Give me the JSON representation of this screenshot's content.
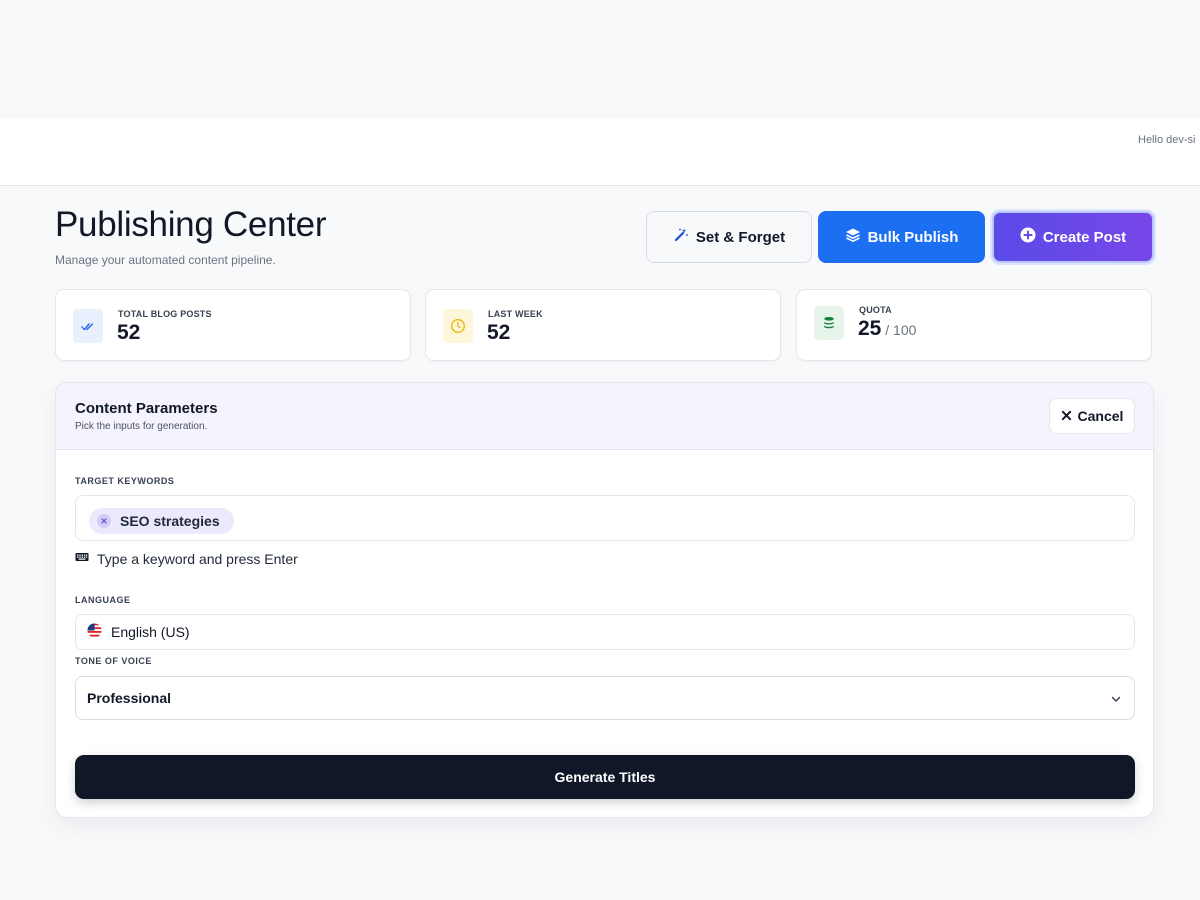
{
  "header": {
    "greeting": "Hello dev-si"
  },
  "page": {
    "title": "Publishing Center",
    "subtitle": "Manage your automated content pipeline."
  },
  "actions": {
    "set_forget": {
      "label": "Set & Forget",
      "icon": "magic-wand-icon"
    },
    "bulk_publish": {
      "label": "Bulk Publish",
      "icon": "layers-icon"
    },
    "create_post": {
      "label": "Create Post",
      "icon": "plus-circle-icon"
    }
  },
  "stats": [
    {
      "label": "TOTAL BLOG POSTS",
      "value": "52",
      "icon": "double-check-icon",
      "color": "#2563eb"
    },
    {
      "label": "LAST WEEK",
      "value": "52",
      "icon": "clock-icon",
      "color": "#eab308"
    },
    {
      "label": "QUOTA",
      "value": "25",
      "suffix": " / 100",
      "icon": "database-icon",
      "color": "#15803d"
    }
  ],
  "panel": {
    "title": "Content Parameters",
    "subtitle": "Pick the inputs for generation.",
    "cancel_label": "Cancel",
    "keywords": {
      "label": "TARGET KEYWORDS",
      "chips": [
        "SEO strategies"
      ],
      "hint": "Type a keyword and press Enter"
    },
    "language": {
      "label": "LANGUAGE",
      "value": "English (US)",
      "icon": "us-flag-icon"
    },
    "tone": {
      "label": "TONE OF VOICE",
      "value": "Professional"
    },
    "generate_label": "Generate Titles"
  },
  "colors": {
    "primary_blue": "#1d6ff2",
    "purple": "#6a48e8",
    "dark": "#101828"
  }
}
